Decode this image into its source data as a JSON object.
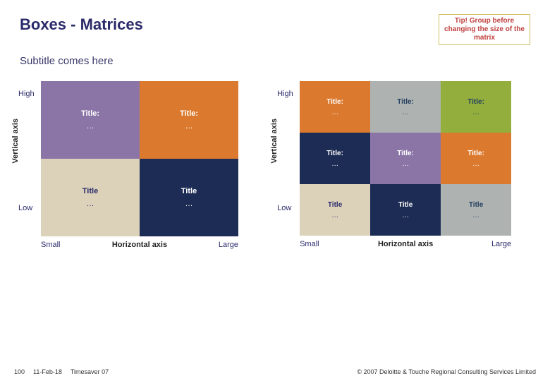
{
  "title": "Boxes - Matrices",
  "tip": "Tip! Group before changing the size of the matrix",
  "subtitle": "Subtitle comes here",
  "axis": {
    "high": "High",
    "low": "Low",
    "small": "Small",
    "large": "Large",
    "vertical": "Vertical axis",
    "horizontal": "Horizontal axis"
  },
  "m2": {
    "cells": [
      {
        "title": "Title:",
        "content": "…"
      },
      {
        "title": "Title:",
        "content": "…"
      },
      {
        "title": "Title",
        "content": "…"
      },
      {
        "title": "Title",
        "content": "…"
      }
    ]
  },
  "m3": {
    "cells": [
      {
        "title": "Title:",
        "content": "…"
      },
      {
        "title": "Title:",
        "content": "…"
      },
      {
        "title": "Title:",
        "content": "…"
      },
      {
        "title": "Title:",
        "content": "…"
      },
      {
        "title": "Title:",
        "content": "…"
      },
      {
        "title": "Title:",
        "content": "…"
      },
      {
        "title": "Title",
        "content": "…"
      },
      {
        "title": "Title",
        "content": "…"
      },
      {
        "title": "Title",
        "content": "…"
      }
    ]
  },
  "footer": {
    "page": "100",
    "date": "11-Feb-18",
    "doc": "Timesaver 07",
    "copyright": "© 2007 Deloitte & Touche Regional Consulting Services Limited"
  },
  "chart_data": [
    {
      "type": "heatmap",
      "title": "2×2 Matrix",
      "xlabel": "Horizontal axis",
      "ylabel": "Vertical axis",
      "x_categories": [
        "Small",
        "Large"
      ],
      "y_categories": [
        "High",
        "Low"
      ],
      "cells": [
        [
          "Title: …",
          "Title: …"
        ],
        [
          "Title …",
          "Title …"
        ]
      ],
      "colors": [
        [
          "#8b75a7",
          "#db7a2e"
        ],
        [
          "#dcd2ba",
          "#1d2c54"
        ]
      ]
    },
    {
      "type": "heatmap",
      "title": "3×3 Matrix",
      "xlabel": "Horizontal axis",
      "ylabel": "Vertical axis",
      "x_categories": [
        "Small",
        "",
        "Large"
      ],
      "y_categories": [
        "High",
        "",
        "Low"
      ],
      "cells": [
        [
          "Title: …",
          "Title: …",
          "Title: …"
        ],
        [
          "Title: …",
          "Title: …",
          "Title: …"
        ],
        [
          "Title …",
          "Title …",
          "Title …"
        ]
      ],
      "colors": [
        [
          "#db7a2e",
          "#aeb3b1",
          "#93ae3d"
        ],
        [
          "#1d2c54",
          "#8b75a7",
          "#db7a2e"
        ],
        [
          "#dcd2ba",
          "#1d2c54",
          "#aeb3b1"
        ]
      ]
    }
  ]
}
